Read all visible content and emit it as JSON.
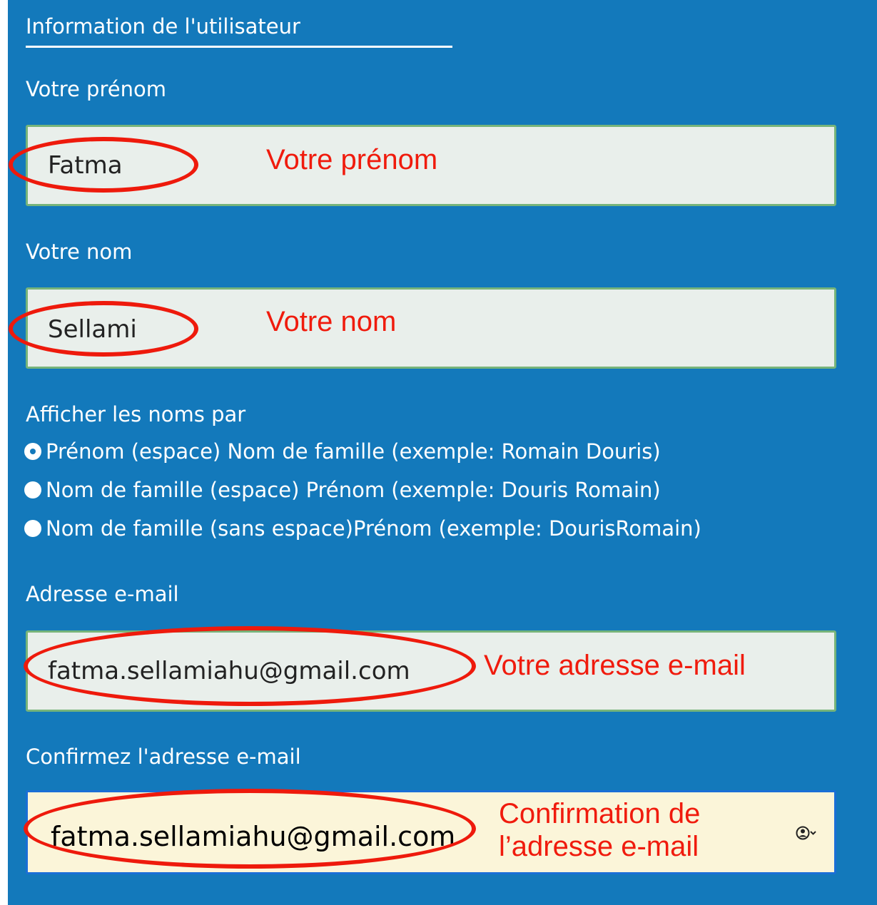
{
  "section": {
    "title": "Information de l'utilisateur"
  },
  "first_name": {
    "label": "Votre prénom",
    "value": "Fatma",
    "annotation": "Votre prénom"
  },
  "last_name": {
    "label": "Votre nom",
    "value": "Sellami",
    "annotation": "Votre nom"
  },
  "display_names": {
    "label": "Afficher les noms par",
    "options": [
      {
        "label": "Prénom (espace) Nom de famille (exemple: Romain Douris)",
        "selected": true
      },
      {
        "label": "Nom de famille (espace) Prénom (exemple: Douris Romain)",
        "selected": false
      },
      {
        "label": "Nom de famille (sans espace)Prénom (exemple: DourisRomain)",
        "selected": false
      }
    ]
  },
  "email": {
    "label": "Adresse e-mail",
    "value": "fatma.sellamiahu@gmail.com",
    "annotation": "Votre adresse e-mail"
  },
  "confirm_email": {
    "label": "Confirmez l'adresse e-mail",
    "value": "fatma.sellamiahu@gmail.com",
    "annotation_line1": "Confirmation de",
    "annotation_line2": "l’adresse e-mail"
  },
  "icons": {
    "autofill": "account-autofill-icon"
  },
  "colors": {
    "panel": "#1379bb",
    "field_bg": "#e9efeb",
    "field_border": "#76b47a",
    "autofill_bg": "#fbf5d9",
    "annotation": "#f01b0d"
  }
}
